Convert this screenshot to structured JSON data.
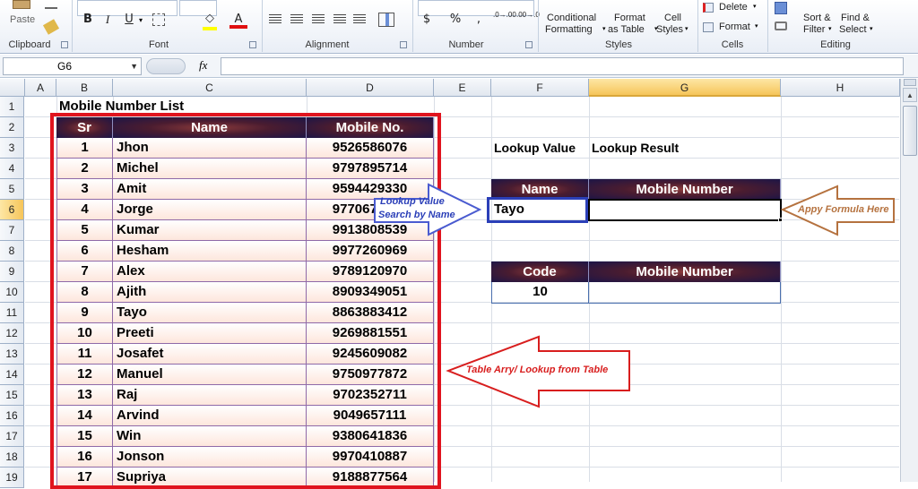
{
  "ribbon": {
    "paste": "Paste",
    "groups": [
      "Clipboard",
      "Font",
      "Alignment",
      "Number",
      "Styles",
      "Cells",
      "Editing"
    ],
    "conditional_formatting": [
      "Conditional",
      "Formatting"
    ],
    "format_as_table": [
      "Format",
      "as Table"
    ],
    "cell_styles": [
      "Cell",
      "Styles"
    ],
    "delete": "Delete",
    "format": "Format",
    "sort_filter": [
      "Sort &",
      "Filter"
    ],
    "find_select": [
      "Find &",
      "Select"
    ],
    "bold": "B",
    "italic": "I",
    "underline": "U",
    "font_color_glyph": "A",
    "currency": "$",
    "percent": "%",
    "dec_inc": ".0→.00",
    "dec_dec": ".00→.0"
  },
  "formula_bar": {
    "name_box": "G6",
    "fx": "fx",
    "value": ""
  },
  "columns": [
    "A",
    "B",
    "C",
    "D",
    "E",
    "F",
    "G",
    "H"
  ],
  "selected_column": "G",
  "rows": [
    "1",
    "2",
    "3",
    "4",
    "5",
    "6",
    "7",
    "8",
    "9",
    "10",
    "11",
    "12",
    "13",
    "14",
    "15",
    "16",
    "17",
    "18",
    "19"
  ],
  "selected_row": "6",
  "sheet": {
    "title": "Mobile Number List",
    "table_headers": [
      "Sr",
      "Name",
      "Mobile No."
    ],
    "table_rows": [
      [
        "1",
        "Jhon",
        "9526586076"
      ],
      [
        "2",
        "Michel",
        "9797895714"
      ],
      [
        "3",
        "Amit",
        "9594429330"
      ],
      [
        "4",
        "Jorge",
        "9770671234"
      ],
      [
        "5",
        "Kumar",
        "9913808539"
      ],
      [
        "6",
        "Hesham",
        "9977260969"
      ],
      [
        "7",
        "Alex",
        "9789120970"
      ],
      [
        "8",
        "Ajith",
        "8909349051"
      ],
      [
        "9",
        "Tayo",
        "8863883412"
      ],
      [
        "10",
        "Preeti",
        "9269881551"
      ],
      [
        "11",
        "Josafet",
        "9245609082"
      ],
      [
        "12",
        "Manuel",
        "9750977872"
      ],
      [
        "13",
        "Raj",
        "9702352711"
      ],
      [
        "14",
        "Arvind",
        "9049657111"
      ],
      [
        "15",
        "Win",
        "9380641836"
      ],
      [
        "16",
        "Jonson",
        "9970410887"
      ],
      [
        "17",
        "Supriya",
        "9188877564"
      ]
    ],
    "lookup_value_label": "Lookup Value",
    "lookup_result_label": "Lookup Result",
    "lookup1": {
      "col1": "Name",
      "col2": "Mobile Number",
      "value": "Tayo",
      "result": ""
    },
    "lookup2": {
      "col1": "Code",
      "col2": "Mobile Number",
      "value": "10",
      "result": ""
    }
  },
  "annotations": {
    "blue_arrow": [
      "Lookup Value",
      "Search by Name"
    ],
    "brown_arrow": "Appy Formula Here",
    "red_arrow": "Table Arry/ Lookup from Table"
  },
  "colors": {
    "table_header_dark": "#1c1547",
    "table_border_red": "#e0141e",
    "lookup_box_blue": "#2b3fb8",
    "arrow_brown": "#b5723f",
    "arrow_blue": "#4a5bd0",
    "selection_orange": "#f6c55a"
  }
}
